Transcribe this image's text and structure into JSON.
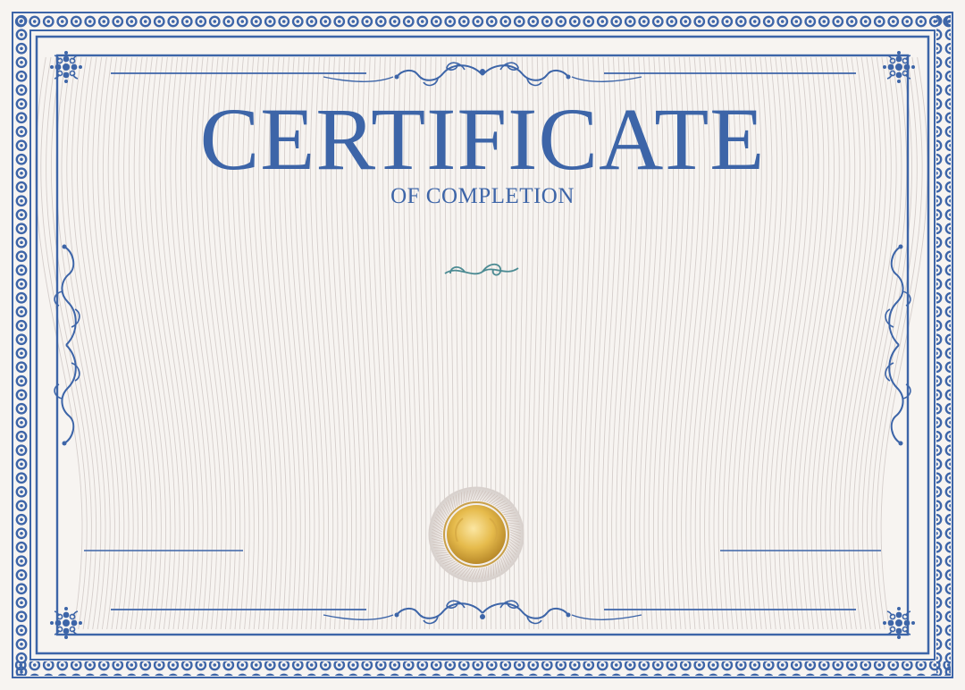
{
  "certificate": {
    "title": "CERTIFICATE",
    "subtitle": "OF COMPLETION"
  },
  "colors": {
    "border_blue": "#3d65a8",
    "background": "#f7f4f1",
    "guilloche_line": "#cfc7c4",
    "divider_teal": "#4c8b93",
    "seal_gold": "#e3b847"
  },
  "icons": {
    "corner": "rosette-ornament-icon",
    "top_flourish": "scroll-flourish-icon",
    "center_divider": "swirl-divider-icon",
    "side_flourish": "vertical-scroll-icon",
    "seal": "gold-seal-icon"
  }
}
